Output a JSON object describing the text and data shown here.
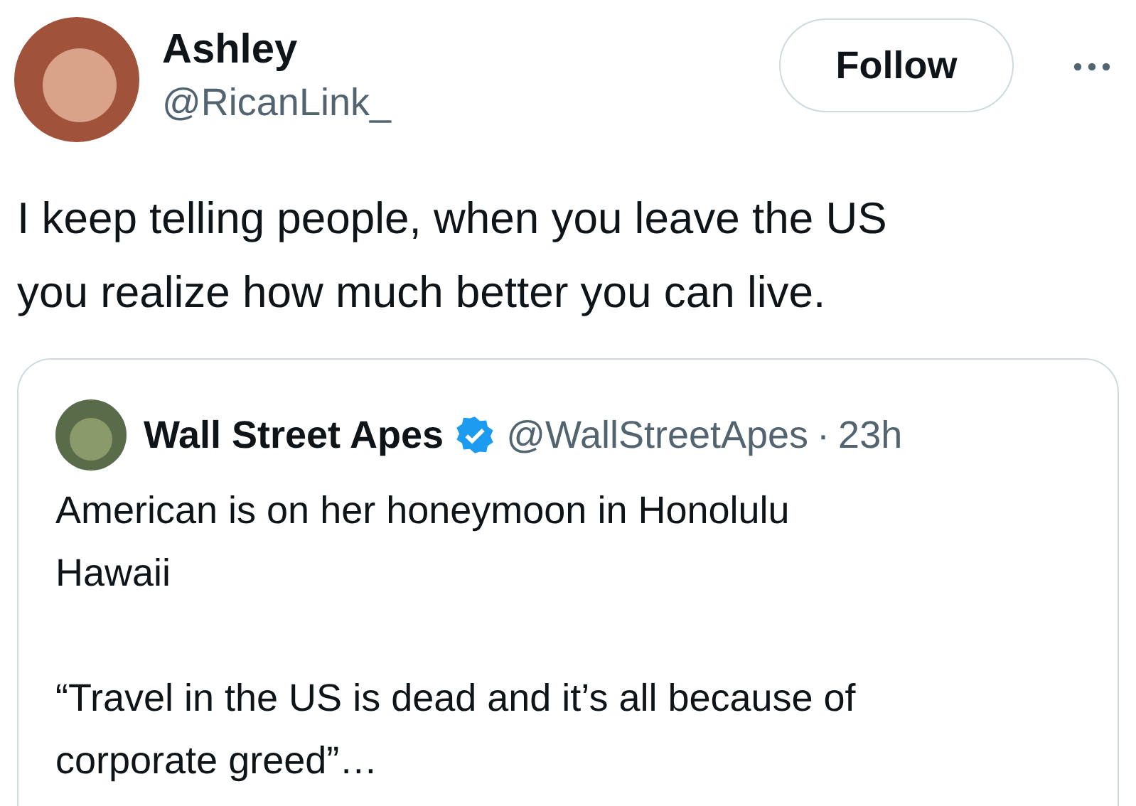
{
  "author": {
    "name": "Ashley",
    "handle": "@RicanLink_"
  },
  "follow_button": {
    "label": "Follow"
  },
  "text": "I keep telling people, when you leave the US\nyou realize how much better you can live.",
  "quoted": {
    "name": "Wall Street Apes",
    "verified": true,
    "handle": "@WallStreetApes",
    "separator": "·",
    "time": "23h",
    "text": "American is on her honeymoon in Honolulu\nHawaii\n\n“Travel in the US is dead and it’s all because of\ncorporate greed”…"
  }
}
